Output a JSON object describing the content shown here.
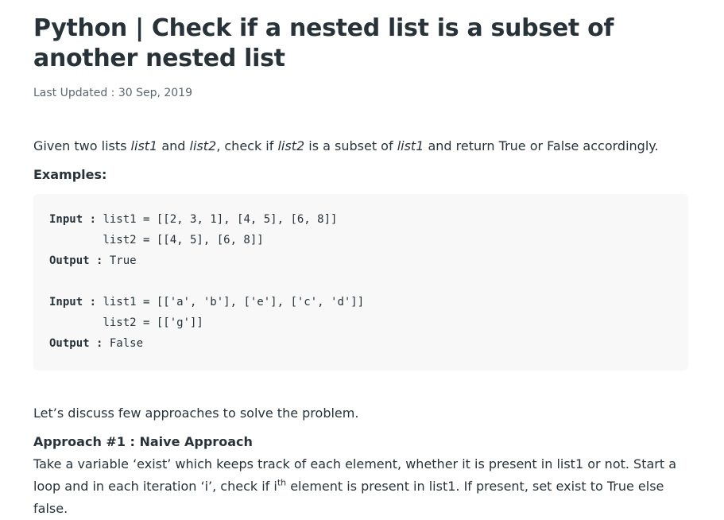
{
  "article": {
    "title": "Python | Check if a nested list is a subset of another nested list",
    "last_updated": "Last Updated : 30 Sep, 2019",
    "intro": {
      "p1": "Given two lists ",
      "list1": "list1",
      "p2": " and ",
      "list2": "list2",
      "p3": ", check if ",
      "list2b": "list2",
      "p4": " is a subset of ",
      "list1b": "list1",
      "p5": " and return True or False accordingly."
    },
    "examples_heading": "Examples:",
    "code": {
      "ex1_input_label": "Input :",
      "ex1_input_line1": " list1 = [[2, 3, 1], [4, 5], [6, 8]]",
      "ex1_input_line2": "        list2 = [[4, 5], [6, 8]]",
      "ex1_output_label": "Output :",
      "ex1_output_value": " True",
      "ex2_input_label": "Input :",
      "ex2_input_line1": " list1 = [['a', 'b'], ['e'], ['c', 'd']]",
      "ex2_input_line2": "        list2 = [['g']]",
      "ex2_output_label": "Output :",
      "ex2_output_value": " False"
    },
    "discuss": "Let’s discuss few approaches to solve the problem.",
    "approach_heading": "Approach #1 : Naive Approach",
    "approach_body": {
      "line1": "Take a variable ‘exist’ which keeps track of each element, whether it is present in list1 or not. Start a loop",
      "line2a": "and in each iteration ‘i’, check if i",
      "sup": "th",
      "line2b": " element is present in list1. If present, set exist to True else false."
    }
  }
}
